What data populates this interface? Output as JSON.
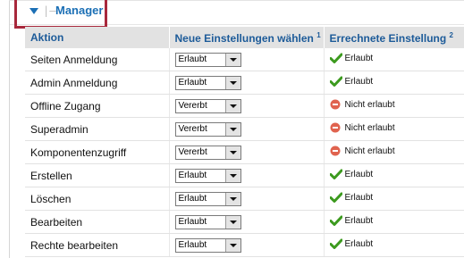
{
  "section": {
    "title": "Manager",
    "tree_glyph": "|—"
  },
  "table": {
    "headers": {
      "action": "Aktion",
      "new_setting": "Neue Einstellungen wählen",
      "new_setting_sup": "1",
      "calculated": "Errechnete Einstellung",
      "calculated_sup": "2"
    },
    "rows": [
      {
        "action": "Seiten Anmeldung",
        "select": "Erlaubt",
        "result": "Erlaubt",
        "status": "allowed"
      },
      {
        "action": "Admin Anmeldung",
        "select": "Erlaubt",
        "result": "Erlaubt",
        "status": "allowed"
      },
      {
        "action": "Offline Zugang",
        "select": "Vererbt",
        "result": "Nicht erlaubt",
        "status": "denied"
      },
      {
        "action": "Superadmin",
        "select": "Vererbt",
        "result": "Nicht erlaubt",
        "status": "denied"
      },
      {
        "action": "Komponentenzugriff",
        "select": "Vererbt",
        "result": "Nicht erlaubt",
        "status": "denied"
      },
      {
        "action": "Erstellen",
        "select": "Erlaubt",
        "result": "Erlaubt",
        "status": "allowed"
      },
      {
        "action": "Löschen",
        "select": "Erlaubt",
        "result": "Erlaubt",
        "status": "allowed"
      },
      {
        "action": "Bearbeiten",
        "select": "Erlaubt",
        "result": "Erlaubt",
        "status": "allowed"
      },
      {
        "action": "Rechte bearbeiten",
        "select": "Erlaubt",
        "result": "Erlaubt",
        "status": "allowed"
      }
    ]
  },
  "colors": {
    "accent_blue": "#1b6fb5",
    "header_text": "#1d5b99",
    "highlight_frame": "#a8283c",
    "allowed_green": "#3c9a1e",
    "denied_red": "#e0634f"
  },
  "icons": {
    "allowed": "check-icon",
    "denied": "minus-circle-icon",
    "toggle": "triangle-down-icon",
    "dropdown": "chevron-down-icon"
  }
}
